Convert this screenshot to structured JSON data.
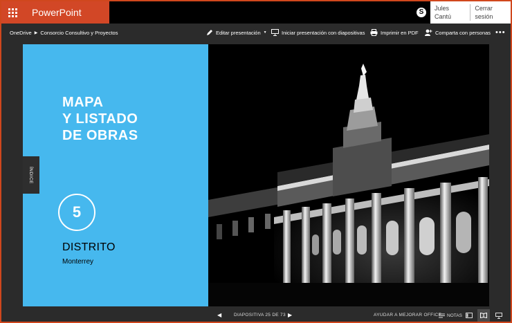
{
  "app": {
    "name": "PowerPoint Online"
  },
  "user": {
    "name": "Jules Cantú",
    "signout": "Cerrar sesión"
  },
  "breadcrumb": {
    "root": "OneDrive",
    "document": "Consorcio Consultivo y Proyectos"
  },
  "toolbar": {
    "edit": "Editar presentación",
    "slideshow": "Iniciar presentación con diapositivas",
    "print": "Imprimir en PDF",
    "share": "Comparta con personas",
    "more": "•••"
  },
  "slide": {
    "title_lines": [
      "MAPA",
      "Y LISTADO",
      "DE OBRAS"
    ],
    "tab_label": "ÍNDICE",
    "number": "5",
    "subtitle": "DISTRITO",
    "city": "Monterrey"
  },
  "status": {
    "counter": "DIAPOSITIVA 25 DE 73",
    "improve": "AYUDAR A MEJORAR OFFICE",
    "notes": "NOTAS"
  },
  "colors": {
    "brand": "#d24726",
    "slide_accent": "#46b8ee",
    "chrome": "#2b2b2b"
  },
  "icons": [
    "waffle-icon",
    "skype-icon",
    "edit-icon",
    "slideshow-icon",
    "print-icon",
    "share-icon",
    "notes-icon",
    "normal-view-icon",
    "reading-view-icon",
    "slideshow-view-icon"
  ]
}
